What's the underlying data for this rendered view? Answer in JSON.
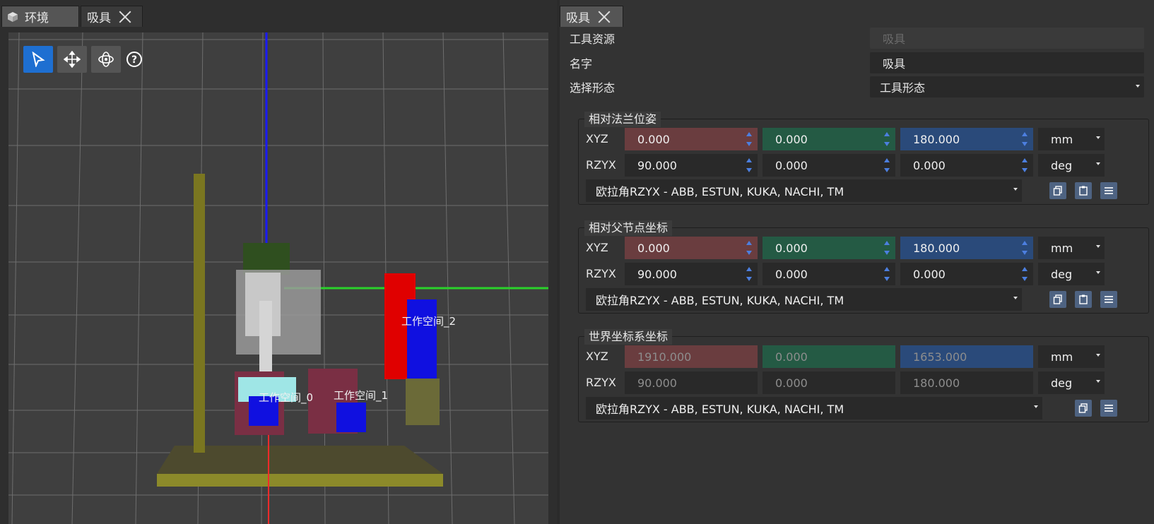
{
  "left_tabs": [
    {
      "label": "环境",
      "active": true
    },
    {
      "label": "吸具",
      "active": false
    }
  ],
  "viewport": {
    "tools": [
      "select-arrow-icon",
      "move-icon",
      "orbit-icon",
      "help-icon"
    ],
    "workspace_labels": [
      "工作空间_0",
      "工作空间_1",
      "工作空间_2"
    ]
  },
  "right_tab": {
    "label": "吸具"
  },
  "properties": {
    "tool_resource": {
      "label": "工具资源",
      "value": "吸具"
    },
    "name": {
      "label": "名字",
      "value": "吸具"
    },
    "shape": {
      "label": "选择形态",
      "value": "工具形态"
    }
  },
  "groups": [
    {
      "title": "相对法兰位姿",
      "xyz": {
        "label": "XYZ",
        "values": [
          "0.000",
          "0.000",
          "180.000"
        ],
        "unit": "mm"
      },
      "rzyx": {
        "label": "RZYX",
        "values": [
          "90.000",
          "0.000",
          "0.000"
        ],
        "unit": "deg"
      },
      "euler": "欧拉角RZYX - ABB, ESTUN, KUKA, NACHI, TM"
    },
    {
      "title": "相对父节点坐标",
      "xyz": {
        "label": "XYZ",
        "values": [
          "0.000",
          "0.000",
          "180.000"
        ],
        "unit": "mm"
      },
      "rzyx": {
        "label": "RZYX",
        "values": [
          "90.000",
          "0.000",
          "0.000"
        ],
        "unit": "deg"
      },
      "euler": "欧拉角RZYX - ABB, ESTUN, KUKA, NACHI, TM"
    },
    {
      "title": "世界坐标系坐标",
      "xyz": {
        "label": "XYZ",
        "values": [
          "1910.000",
          "0.000",
          "1653.000"
        ],
        "unit": "mm"
      },
      "rzyx": {
        "label": "RZYX",
        "values": [
          "90.000",
          "0.000",
          "180.000"
        ],
        "unit": "deg"
      },
      "euler": "欧拉角RZYX - ABB, ESTUN, KUKA, NACHI, TM"
    }
  ],
  "colors": {
    "accent": "#1e6fd1",
    "x_field": "#6a3d3f",
    "y_field": "#245a44",
    "z_field": "#2a4a7a"
  }
}
